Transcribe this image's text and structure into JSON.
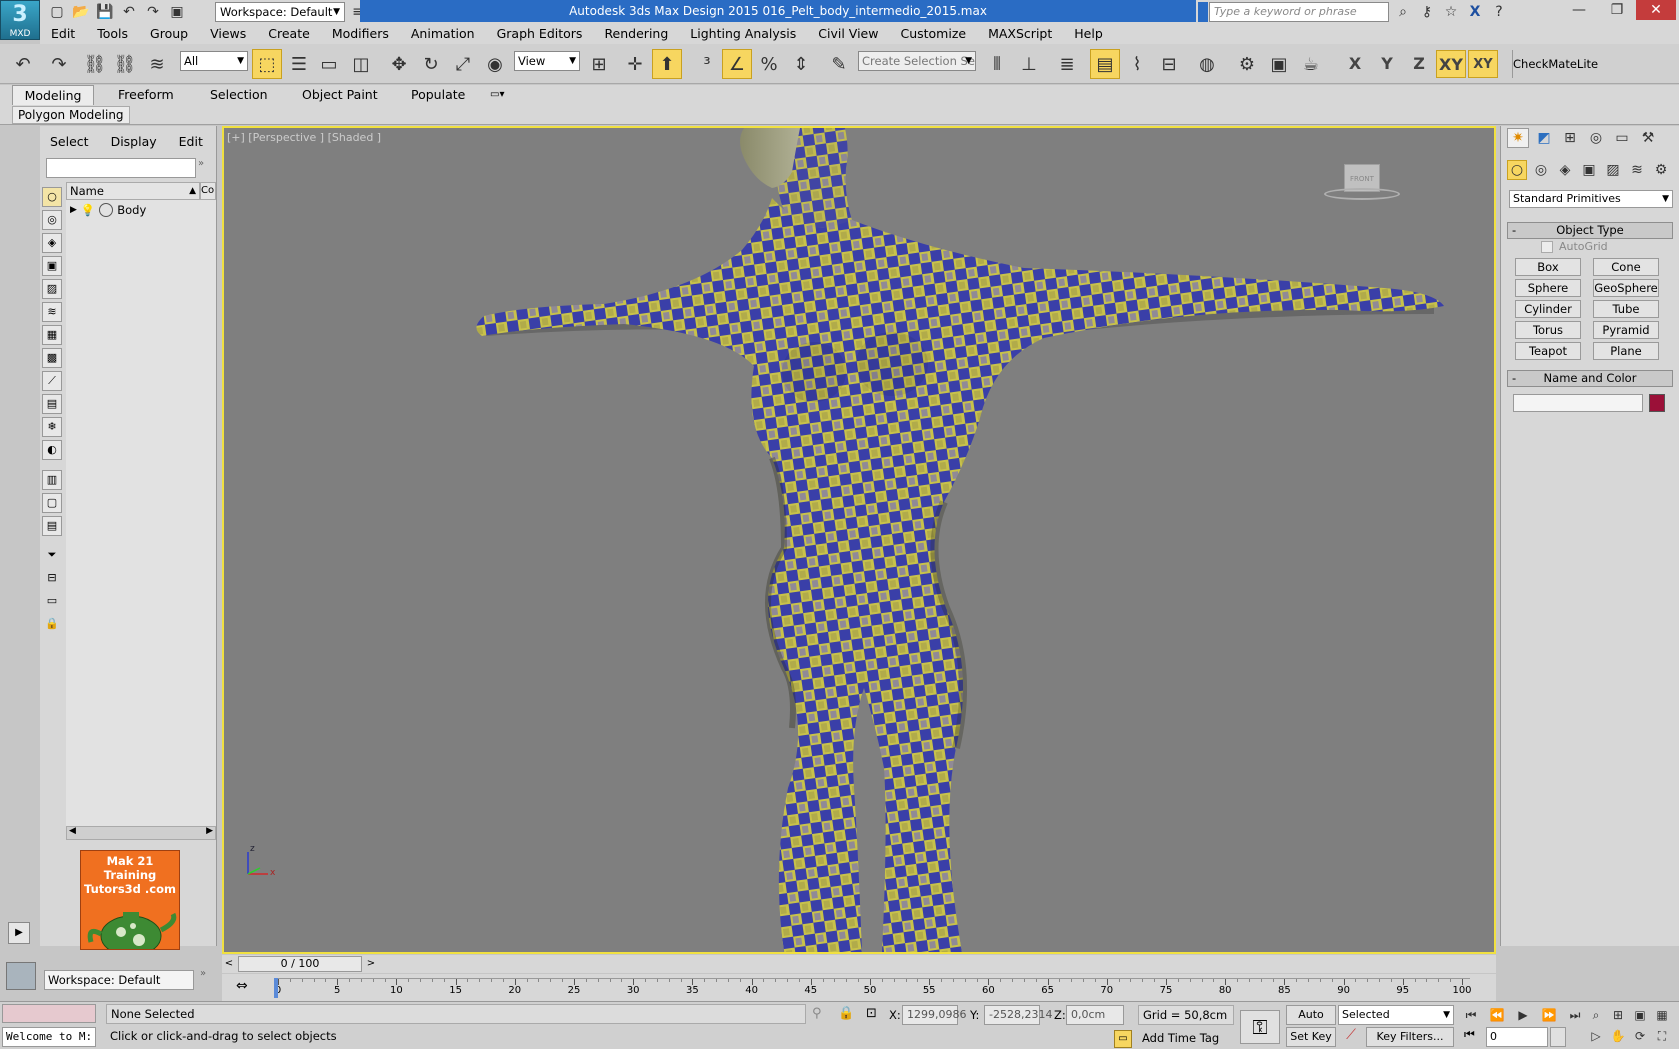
{
  "app": {
    "logo_label": "MXD",
    "workspace": "Workspace: Default",
    "title": "Autodesk 3ds Max Design 2015      016_Pelt_body_intermedio_2015.max",
    "search_placeholder": "Type a keyword or phrase"
  },
  "menu": [
    "Edit",
    "Tools",
    "Group",
    "Views",
    "Create",
    "Modifiers",
    "Animation",
    "Graph Editors",
    "Rendering",
    "Lighting Analysis",
    "Civil View",
    "Customize",
    "MAXScript",
    "Help"
  ],
  "toolbar": {
    "filter_value": "All",
    "ref_coord": "View",
    "named_selection_placeholder": "Create Selection Se",
    "axes": [
      "X",
      "Y",
      "Z",
      "XY",
      "XY"
    ],
    "checkmate": "CheckMateLite"
  },
  "ribbon": {
    "tabs": [
      "Modeling",
      "Freeform",
      "Selection",
      "Object Paint",
      "Populate"
    ],
    "active_tab": "Modeling",
    "sub_tab": "Polygon Modeling"
  },
  "scene_explorer": {
    "menu": [
      "Select",
      "Display",
      "Edit"
    ],
    "col_name": "Name",
    "col_extra": "Co",
    "items": [
      {
        "name": "Body"
      }
    ],
    "workspace": "Workspace: Default",
    "promo_line1": "Mak 21 Training",
    "promo_line2": "Tutors3d .com"
  },
  "viewport": {
    "label": "[+] [Perspective ] [Shaded ]",
    "viewcube_label": "FRONT",
    "axis_x": "x",
    "axis_z": "z"
  },
  "command_panel": {
    "category": "Standard Primitives",
    "object_type_title": "Object Type",
    "autogrid": "AutoGrid",
    "buttons": [
      "Box",
      "Cone",
      "Sphere",
      "GeoSphere",
      "Cylinder",
      "Tube",
      "Torus",
      "Pyramid",
      "Teapot",
      "Plane"
    ],
    "name_color_title": "Name and Color",
    "object_color": "#9b1038"
  },
  "timeline": {
    "frame_counter": "0 / 100",
    "ticks": [
      "0",
      "5",
      "10",
      "15",
      "20",
      "25",
      "30",
      "35",
      "40",
      "45",
      "50",
      "55",
      "60",
      "65",
      "70",
      "75",
      "80",
      "85",
      "90",
      "95",
      "100"
    ]
  },
  "status": {
    "maxscript_listener": "Welcome to M:",
    "selection": "None Selected",
    "prompt": "Click or click-and-drag to select objects",
    "x_label": "X:",
    "x_value": "1299,0986",
    "y_label": "Y:",
    "y_value": "-2528,2314",
    "z_label": "Z:",
    "z_value": "0,0cm",
    "grid": "Grid = 50,8cm",
    "add_time_tag": "Add Time Tag",
    "auto_key": "Auto Key",
    "set_key": "Set Key",
    "key_mode": "Selected",
    "key_filters": "Key Filters...",
    "current_frame": "0"
  },
  "colors": {
    "accent_blue": "#2a6cc4",
    "active_yellow": "#f7d660",
    "viewport_border": "#f0e040"
  }
}
